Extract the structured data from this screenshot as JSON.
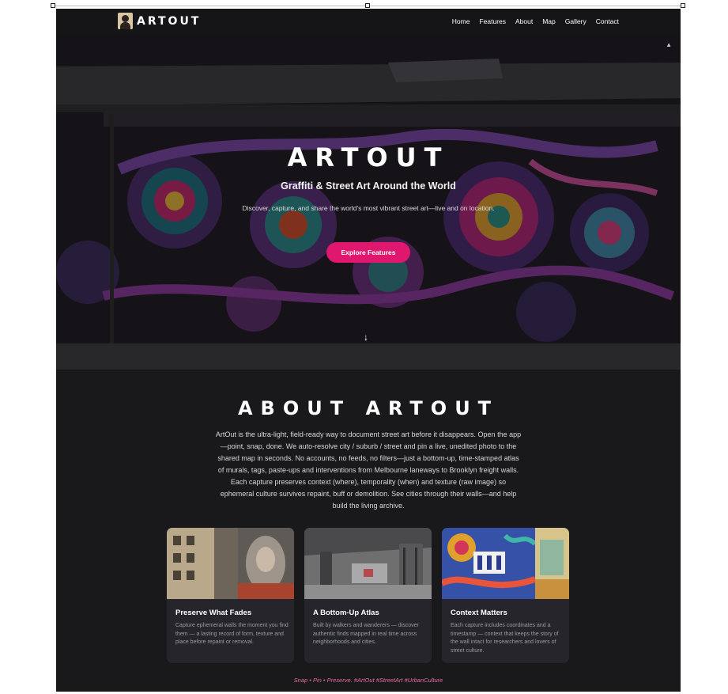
{
  "nav": {
    "logo_text": "ARTOUT",
    "links": [
      "Home",
      "Features",
      "About",
      "Map",
      "Gallery",
      "Contact"
    ]
  },
  "hero": {
    "title": "ARTOUT",
    "subtitle": "Graffiti & Street Art Around the World",
    "description": "Discover, capture, and share the world's most vibrant street art—live and on location.",
    "cta_label": "Explore Features",
    "scroll_icon": "arrow-down-icon",
    "top_icon": "caret-up-icon"
  },
  "about": {
    "title": "ABOUT ARTOUT",
    "body": "ArtOut is the ultra-light, field-ready way to document street art before it disappears. Open the app—point, snap, done. We auto-resolve city / suburb / street and pin a live, unedited photo to the shared map in seconds. No accounts, no feeds, no filters—just a bottom-up, time-stamped atlas of murals, tags, paste-ups and interventions from Melbourne laneways to Brooklyn freight walls. Each capture preserves context (where), temporality (when) and texture (raw image) so ephemeral culture survives repaint, buff or demolition. See cities through their walls—and help build the living archive."
  },
  "cards": [
    {
      "title": "Preserve What Fades",
      "text": "Capture ephemeral walls the moment you find them — a lasting record of form, texture and place before repaint or removal."
    },
    {
      "title": "A Bottom-Up Atlas",
      "text": "Built by walkers and wanderers — discover authentic finds mapped in real time across neighborhoods and cities."
    },
    {
      "title": "Context Matters",
      "text": "Each capture includes coordinates and a timestamp — context that keeps the story of the wall intact for researchers and lovers of street culture."
    }
  ],
  "footer": {
    "tagline": "Snap • Pin • Preserve. #ArtOut #StreetArt #UrbanCulture"
  },
  "colors": {
    "accent": "#e0176e",
    "background": "#19191b",
    "card": "#25252b",
    "tagline": "#e86aa6"
  }
}
